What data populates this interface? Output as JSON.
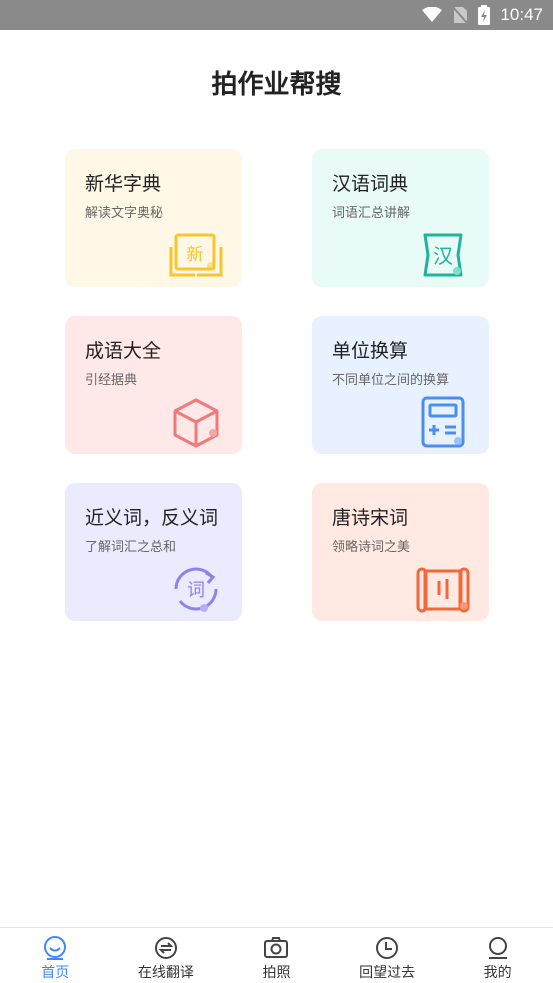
{
  "status_bar": {
    "time": "10:47",
    "icons": [
      "wifi-icon",
      "no-sim-icon",
      "battery-charging-icon"
    ]
  },
  "page": {
    "title": "拍作业帮搜"
  },
  "cards": [
    {
      "title": "新华字典",
      "subtitle": "解读文字奥秘",
      "icon": "book-icon",
      "glyph": "新",
      "bg": "#fff8e6",
      "accent": "#f7c52d"
    },
    {
      "title": "汉语词典",
      "subtitle": "词语汇总讲解",
      "icon": "scroll-icon",
      "glyph": "汉",
      "bg": "#e9fbf6",
      "accent": "#1fb49a"
    },
    {
      "title": "成语大全",
      "subtitle": "引经据典",
      "icon": "cube-icon",
      "bg": "#ffe8e8",
      "accent": "#f07a7a"
    },
    {
      "title": "单位换算",
      "subtitle": "不同单位之间的换算",
      "icon": "calculator-icon",
      "bg": "#e8f1ff",
      "accent": "#4b8ef0"
    },
    {
      "title": "近义词，反义词",
      "subtitle": "了解词汇之总和",
      "icon": "cycle-icon",
      "glyph": "词",
      "bg": "#ebebff",
      "accent": "#8a83ea"
    },
    {
      "title": "唐诗宋词",
      "subtitle": "领略诗词之美",
      "icon": "scroll-icon",
      "glyph": "刂",
      "bg": "#ffe9e2",
      "accent": "#f3683a"
    }
  ],
  "tabbar": {
    "items": [
      {
        "label": "首页",
        "icon": "home-face-icon",
        "active": true
      },
      {
        "label": "在线翻译",
        "icon": "translate-icon",
        "active": false
      },
      {
        "label": "拍照",
        "icon": "camera-icon",
        "active": false
      },
      {
        "label": "回望过去",
        "icon": "clock-icon",
        "active": false
      },
      {
        "label": "我的",
        "icon": "user-icon",
        "active": false
      }
    ]
  },
  "colors": {
    "active_tab": "#3d8af7",
    "status_bar_bg": "#8a8a8a"
  }
}
